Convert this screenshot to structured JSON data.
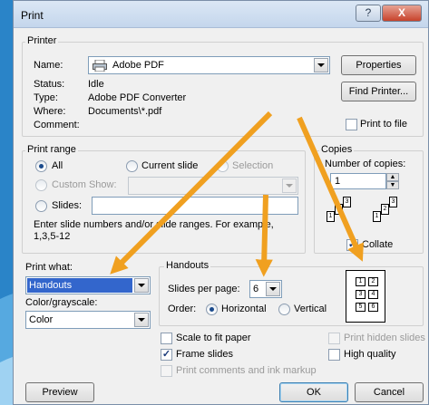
{
  "window": {
    "title": "Print",
    "help_glyph": "?",
    "close_glyph": "X"
  },
  "printer": {
    "group_label": "Printer",
    "name_label": "Name:",
    "name_value": "Adobe PDF",
    "properties_button": "Properties",
    "find_printer_button": "Find Printer...",
    "status_label": "Status:",
    "status_value": "Idle",
    "type_label": "Type:",
    "type_value": "Adobe PDF Converter",
    "where_label": "Where:",
    "where_value": "Documents\\*.pdf",
    "comment_label": "Comment:",
    "print_to_file_label": "Print to file",
    "print_to_file_checked": false
  },
  "print_range": {
    "group_label": "Print range",
    "all_label": "All",
    "current_slide_label": "Current slide",
    "selection_label": "Selection",
    "custom_show_label": "Custom Show:",
    "slides_label": "Slides:",
    "slides_value": "",
    "hint": "Enter slide numbers and/or slide ranges. For example, 1,3,5-12",
    "selected": "All"
  },
  "copies": {
    "group_label": "Copies",
    "number_label": "Number of copies:",
    "number_value": "1",
    "collate_label": "Collate",
    "collate_checked": true,
    "page_labels": [
      "1",
      "2",
      "3"
    ]
  },
  "print_what": {
    "label": "Print what:",
    "value": "Handouts",
    "color_label": "Color/grayscale:",
    "color_value": "Color"
  },
  "handouts": {
    "group_label": "Handouts",
    "slides_per_page_label": "Slides per page:",
    "slides_per_page_value": "6",
    "order_label": "Order:",
    "horizontal_label": "Horizontal",
    "vertical_label": "Vertical",
    "order_selected": "Horizontal",
    "preview_numbers": [
      "1",
      "2",
      "3",
      "4",
      "5",
      "6"
    ]
  },
  "options": {
    "scale_to_fit": {
      "label": "Scale to fit paper",
      "checked": false
    },
    "frame_slides": {
      "label": "Frame slides",
      "checked": true
    },
    "print_comments": {
      "label": "Print comments and ink markup",
      "checked": false
    },
    "print_hidden": {
      "label": "Print hidden slides",
      "checked": false
    },
    "high_quality": {
      "label": "High quality",
      "checked": false
    }
  },
  "buttons": {
    "preview": "Preview",
    "ok": "OK",
    "cancel": "Cancel"
  },
  "colors": {
    "annotation_arrow": "#f0a020",
    "background": "#2f86c6",
    "selection": "#3366cc"
  }
}
